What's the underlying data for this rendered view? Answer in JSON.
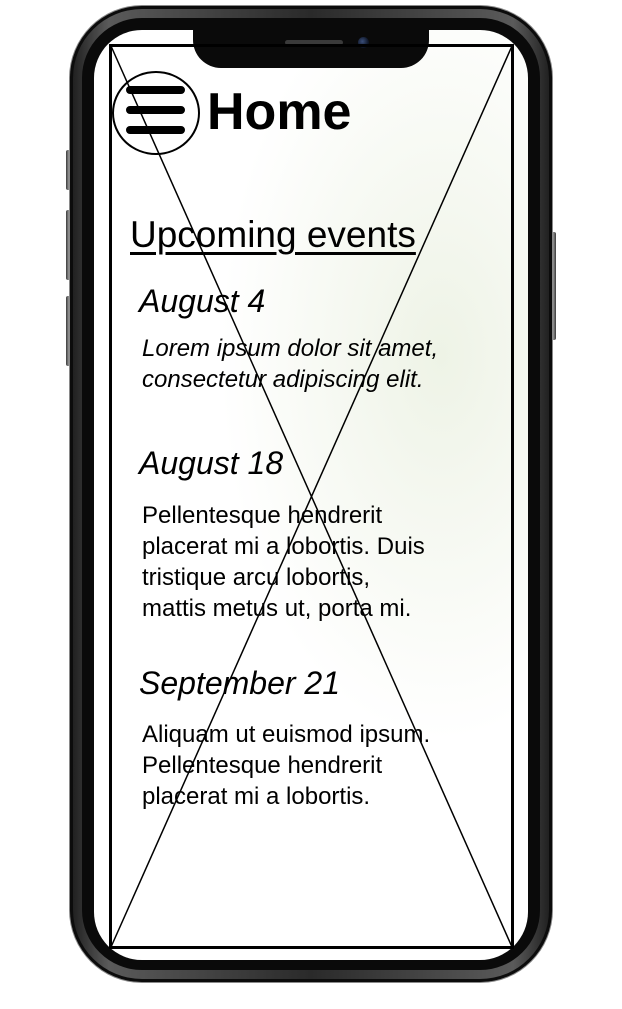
{
  "header": {
    "title": "Home",
    "menu_icon": "hamburger-menu-icon"
  },
  "events_section": {
    "heading": "Upcoming events",
    "events": [
      {
        "date": "August 4",
        "description": "Lorem ipsum dolor sit amet,\nconsectetur adipiscing elit."
      },
      {
        "date": "August 18",
        "description": "Pellentesque hendrerit\nplacerat mi a lobortis. Duis\ntristique arcu lobortis,\nmattis metus ut, porta mi."
      },
      {
        "date": "September 21",
        "description": "Aliquam ut euismod ipsum.\nPellentesque hendrerit\nplacerat mi a lobortis."
      }
    ]
  },
  "colors": {
    "text": "#000000",
    "screen_background": "#ffffff",
    "frame": "#1c1c1c"
  }
}
